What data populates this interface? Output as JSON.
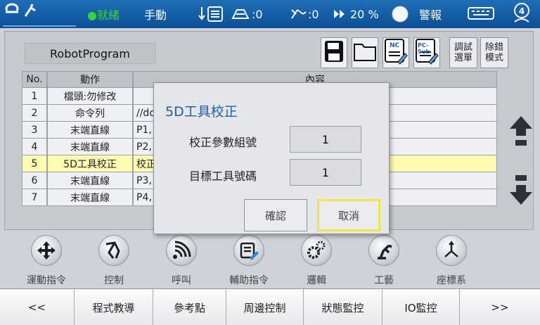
{
  "topbar": {
    "status": "●就緒",
    "mode": "手動",
    "counter_a": ":0",
    "counter_b": ":0",
    "speed": "20 %",
    "alarm": "警報",
    "badge": "4",
    "icons": [
      "robot-logo-icon",
      "list-icon",
      "box-icon",
      "tool-icon",
      "fast-forward-icon",
      "power-icon",
      "keyboard-icon",
      "person-icon"
    ]
  },
  "program": {
    "name": "RobotProgram"
  },
  "toolbar": {
    "icons": [
      "save-icon",
      "folder-icon",
      "nc-file-icon",
      "pc-sub-file-icon"
    ],
    "nc_label": "NC",
    "pcsub_label": "PC-Sub",
    "debug_menu": "調試\n選單",
    "remove_mode": "除錯\n模式"
  },
  "table": {
    "headers": [
      "No.",
      "動作",
      "內容"
    ],
    "rows": [
      {
        "no": "1",
        "action": "檔頭:勿修改",
        "content": ""
      },
      {
        "no": "2",
        "action": "命令列",
        "content": "//do"
      },
      {
        "no": "3",
        "action": "末端直線",
        "content": "P1,"
      },
      {
        "no": "4",
        "action": "末端直線",
        "content": "P2,"
      },
      {
        "no": "5",
        "action": "5D工具校正",
        "content": "校正"
      },
      {
        "no": "6",
        "action": "末端直線",
        "content": "P3,"
      },
      {
        "no": "7",
        "action": "末端直線",
        "content": "P4,"
      }
    ],
    "selected_row": 5
  },
  "dialog": {
    "title": "5D工具校正",
    "param_label": "校正參數組號",
    "param_value": "1",
    "tool_label": "目標工具號碼",
    "tool_value": "1",
    "confirm": "確認",
    "cancel": "取消"
  },
  "categories": [
    {
      "label": "運動指令",
      "icon": "move-arrows-icon"
    },
    {
      "label": "控制",
      "icon": "robot-arm-icon"
    },
    {
      "label": "呼叫",
      "icon": "signal-icon"
    },
    {
      "label": "輔助指令",
      "icon": "edit-note-icon"
    },
    {
      "label": "邏輯",
      "icon": "gears-icon"
    },
    {
      "label": "工藝",
      "icon": "welding-arm-icon"
    },
    {
      "label": "座標系",
      "icon": "axes-icon"
    }
  ],
  "bottom": [
    "<<",
    "程式教導",
    "參考點",
    "周邊控制",
    "狀態監控",
    "IO監控",
    ">>"
  ],
  "colors": {
    "topbar": "#0b4f96",
    "status_green": "#39d33b",
    "selected_row": "#fffbb0",
    "dialog_title": "#1f5fae",
    "cancel_border": "#f3e24a"
  }
}
